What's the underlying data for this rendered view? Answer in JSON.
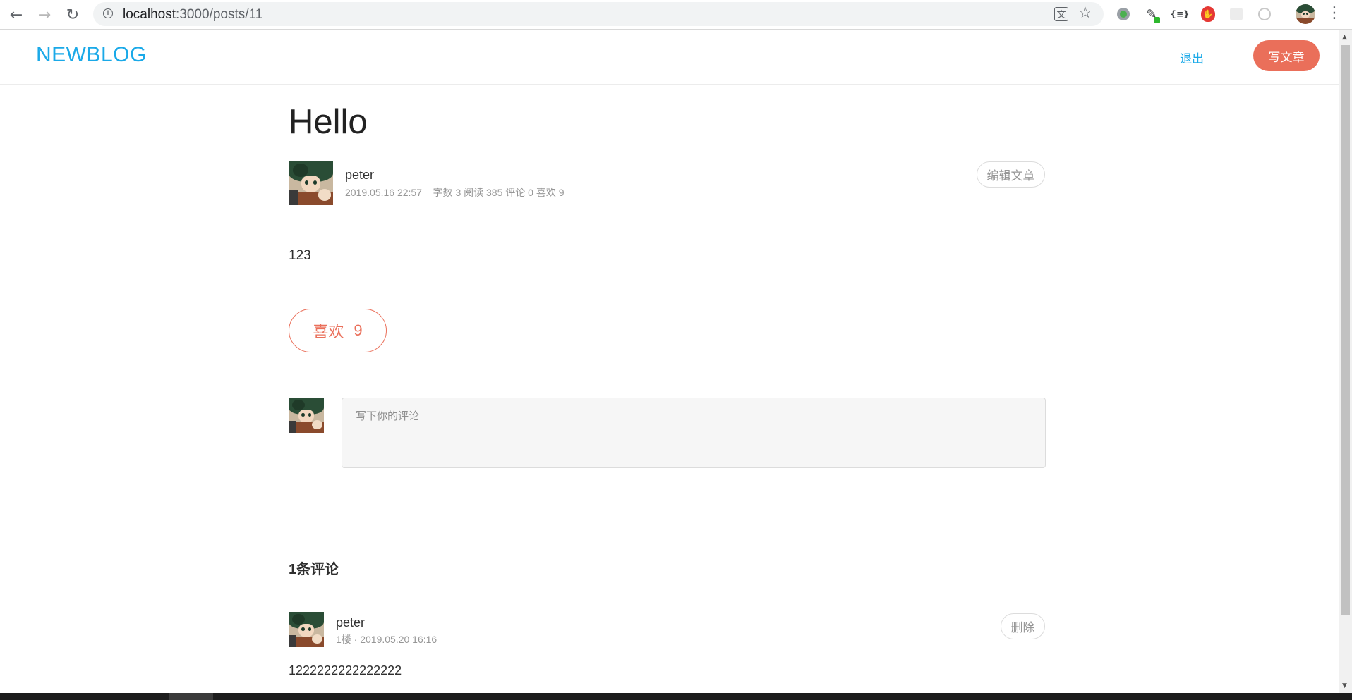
{
  "browser": {
    "url_host": "localhost",
    "url_path": ":3000/posts/11",
    "icons": [
      "back-icon",
      "forward-icon",
      "reload-icon",
      "info-icon",
      "translate-icon",
      "star-icon",
      "extension-circle-icon",
      "eyedropper-icon",
      "json-icon",
      "shield-icon",
      "extension-faded-icon",
      "record-icon",
      "profile-avatar",
      "more-menu-icon"
    ]
  },
  "header": {
    "brand": "NEWBLOG",
    "logout": "退出",
    "write": "写文章",
    "brand_color": "#1aa9e8",
    "accent_color": "#ea6f5a"
  },
  "post": {
    "title": "Hello",
    "author": "peter",
    "meta": "2019.05.16 22:57    字数 3 阅读 385 评论 0 喜欢 9",
    "edit_label": "编辑文章",
    "body": "123",
    "like_label": "喜欢",
    "like_count": "9"
  },
  "comment_form": {
    "placeholder": "写下你的评论"
  },
  "comments": {
    "heading": "1条评论",
    "items": [
      {
        "author": "peter",
        "meta": "1楼 · 2019.05.20 16:16",
        "delete_label": "删除",
        "text": "1222222222222222"
      }
    ]
  }
}
